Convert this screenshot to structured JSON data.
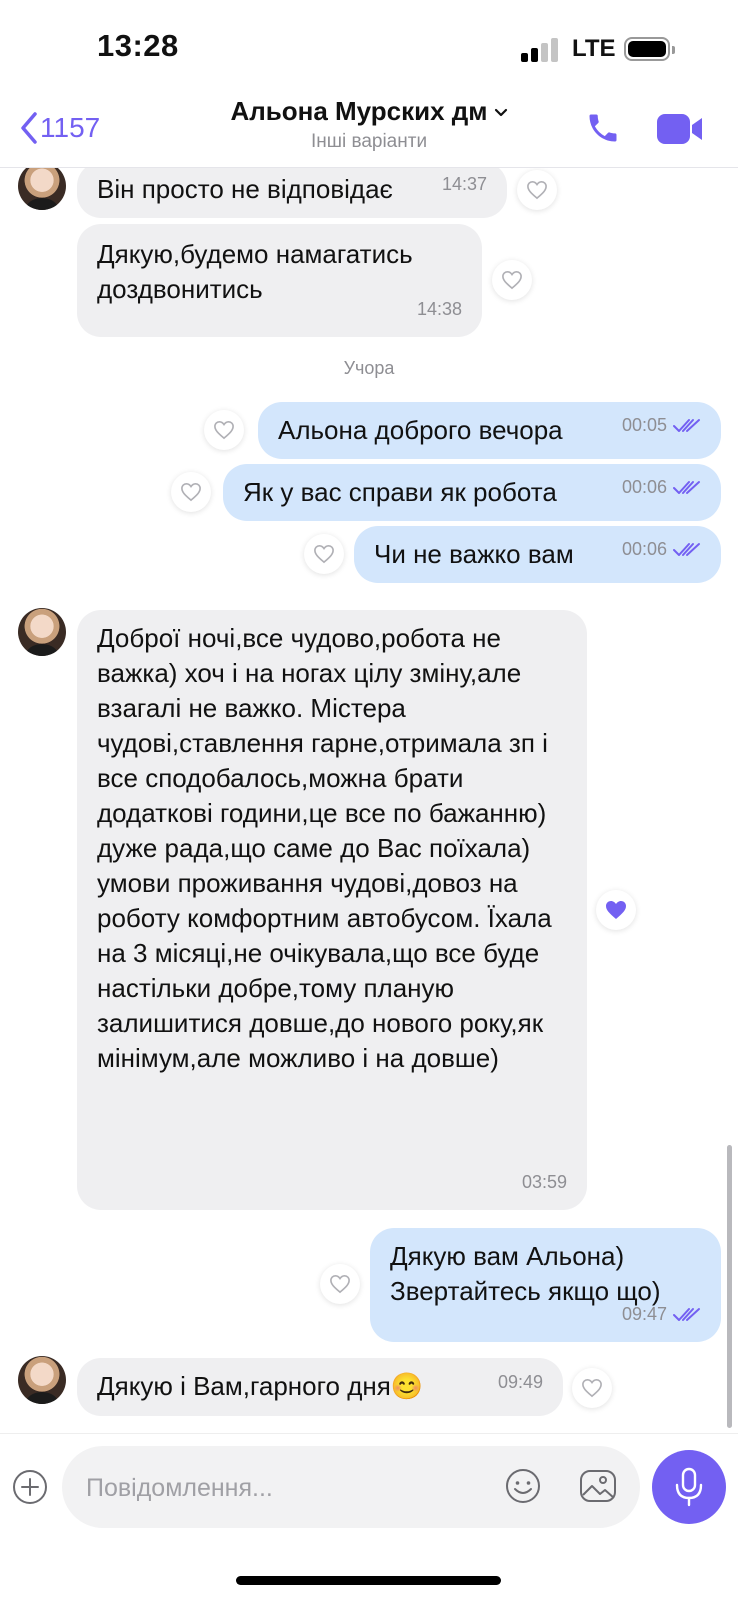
{
  "status_bar": {
    "time": "13:28",
    "network": "LTE"
  },
  "header": {
    "back_count": "1157",
    "contact_name": "Альона Мурских дм",
    "subtitle": "Інші варіанти"
  },
  "messages": [
    {
      "side": "in",
      "text": "Він просто не відповідає",
      "time": "14:37"
    },
    {
      "side": "in",
      "text": "Дякую,будемо намагатись доздвонитись",
      "time": "14:38"
    },
    {
      "side": "out",
      "text": "Альона доброго вечора",
      "time": "00:05"
    },
    {
      "side": "out",
      "text": "Як у вас справи як робота",
      "time": "00:06"
    },
    {
      "side": "out",
      "text": "Чи не важко вам",
      "time": "00:06"
    },
    {
      "side": "in",
      "text": "Доброї ночі,все чудово,робота не важка) хоч і на ногах цілу зміну,але взагалі не важко. Містера чудові,ставлення гарне,отримала зп і все сподобалось,можна брати додаткові години,це все по бажанню) дуже рада,що саме до Вас поїхала) умови проживання чудові,довоз на роботу комфортним автобусом. Їхала на 3 місяці,не очікувала,що все буде настільки добре,тому планую залишитися довше,до нового року,як мінімум,але можливо і на довше)",
      "time": "03:59",
      "liked": true
    },
    {
      "side": "out",
      "text": "Дякую вам Альона) Звертайтесь якщо що)",
      "time": "09:47"
    },
    {
      "side": "in",
      "text": "Дякую і Вам,гарного дня😊",
      "time": "09:49"
    }
  ],
  "date_divider": "Учора",
  "composer": {
    "placeholder": "Повідомлення..."
  },
  "colors": {
    "accent": "#7360f2",
    "incoming_bubble": "#efeff1",
    "outgoing_bubble": "#d3e6fc",
    "read_ticks": "#7360f2"
  },
  "icons": [
    "back-chevron-icon",
    "chevron-down-icon",
    "phone-icon",
    "video-camera-icon",
    "heart-icon",
    "double-check-icon",
    "plus-icon",
    "sticker-icon",
    "gallery-icon",
    "microphone-icon"
  ]
}
